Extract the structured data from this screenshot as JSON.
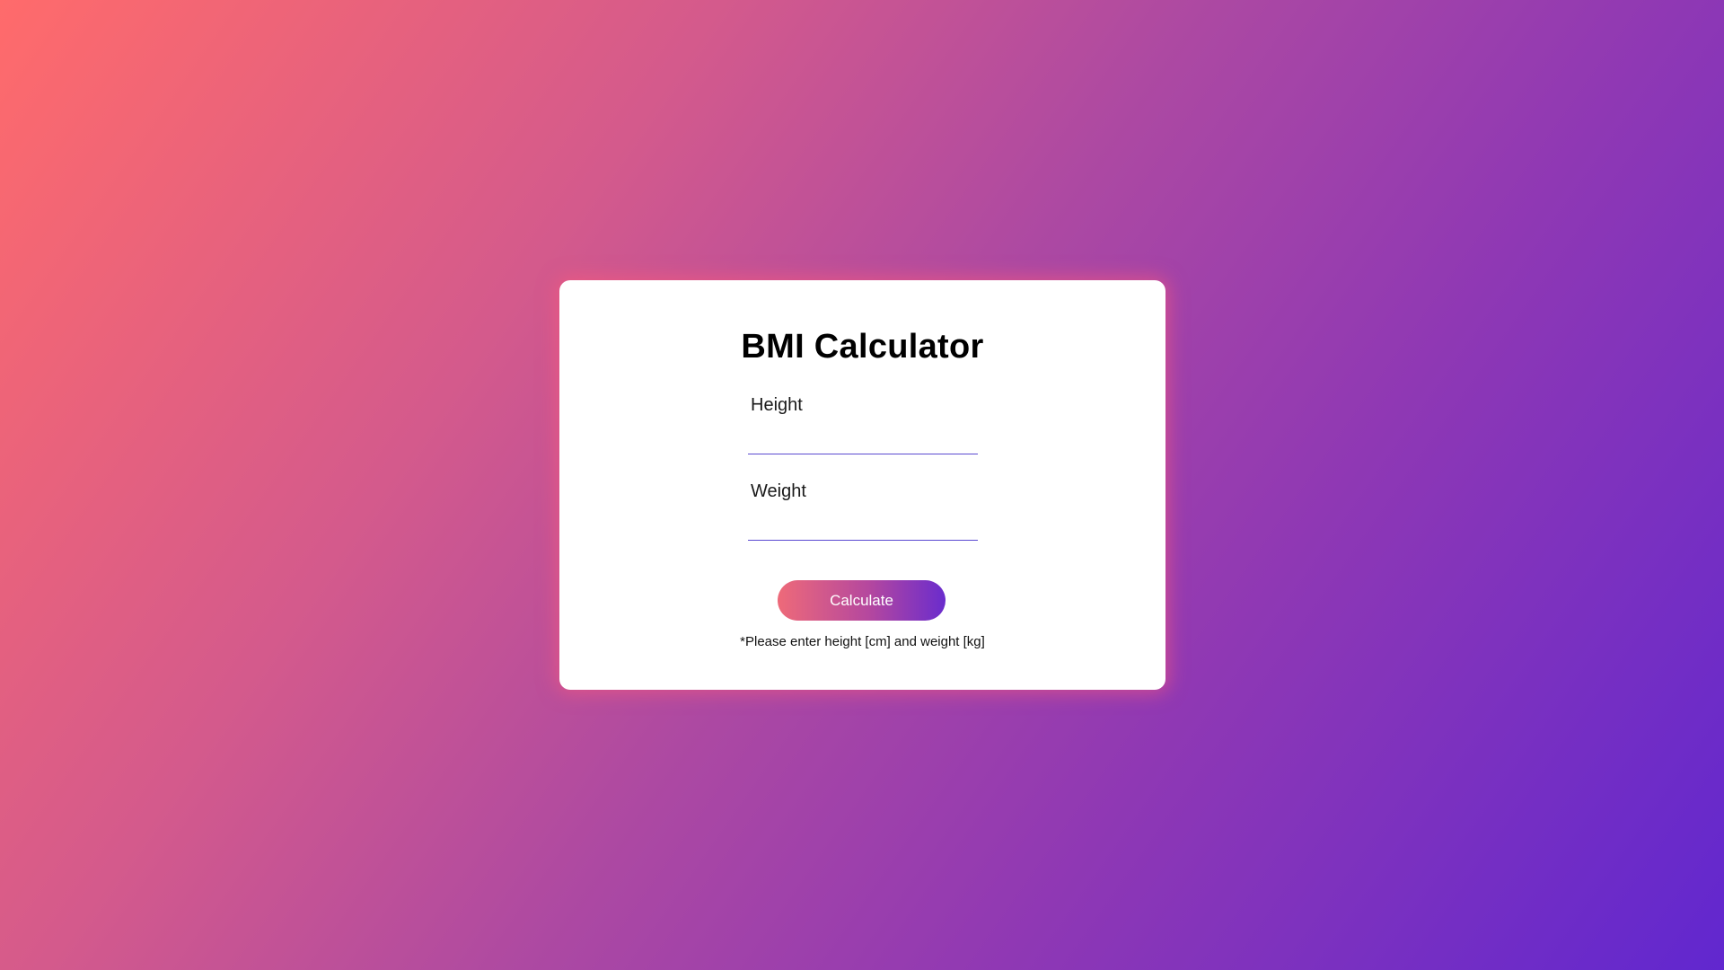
{
  "app": {
    "title": "BMI Calculator"
  },
  "form": {
    "height_label": "Height",
    "height_value": "",
    "weight_label": "Weight",
    "weight_value": "",
    "button_label": "Calculate",
    "note": "*Please enter height [cm] and weight [kg]"
  },
  "colors": {
    "background_start": "#ff6b6b",
    "background_end": "#6127cf",
    "card": "#ffffff",
    "input_underline": "#5b4ad1",
    "button_start": "#ee6a79",
    "button_end": "#6a2ccd"
  }
}
